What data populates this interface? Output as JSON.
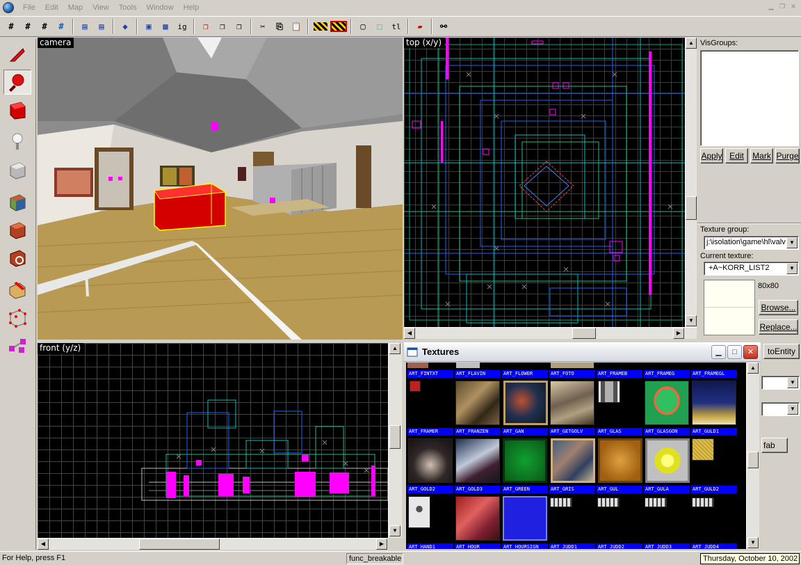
{
  "menu": {
    "items": [
      "File",
      "Edit",
      "Map",
      "View",
      "Tools",
      "Window",
      "Help"
    ]
  },
  "views": {
    "camera": "camera",
    "top": "top (x/y)",
    "front": "front (y/z)"
  },
  "right_panel": {
    "visgroups_label": "VisGroups:",
    "apply": "Apply",
    "edit": "Edit",
    "mark": "Mark",
    "purge": "Purge",
    "texture_group_label": "Texture group:",
    "texture_group_value": "j:\\isolation\\game\\hl\\valv",
    "current_texture_label": "Current texture:",
    "current_texture_value": "+A~KORR_LIST2",
    "texture_size": "80x80",
    "browse": "Browse...",
    "replace": "Replace...",
    "to_entity": "toEntity",
    "prefab_fragment": "fab"
  },
  "textures_window": {
    "title": "Textures",
    "rows": [
      [
        "ART_FINTXT",
        "ART_FLAVIN",
        "ART_FLOWER",
        "ART_FOTO",
        "ART_FRAMEB",
        "ART_FRAMEG",
        "ART_FRAMEGL"
      ],
      [
        "ART_FRAMER",
        "ART_FRANZEN",
        "ART_GAN",
        "ART_GETGOLV",
        "ART_GLAS",
        "ART_GLASGON",
        "ART_GULD1"
      ],
      [
        "ART_GOLD2",
        "ART_GOLD3",
        "ART_GREEN",
        "ART_GRIS",
        "ART_GUL",
        "ART_GULA",
        "ART_GULD2"
      ],
      [
        "ART_HAND1",
        "ART_HOUR",
        "ART_HOURSIGN",
        "ART_JUDD1",
        "ART_JUDD2",
        "ART_JUDD3",
        "ART_JUDD4"
      ]
    ]
  },
  "status": {
    "help": "For Help, press F1",
    "selection": "func_breakable",
    "date": "Thursday, October 10, 2002"
  },
  "colors": {
    "selected_brush": "#d40000",
    "entity_magenta": "#ff00ff",
    "texture_label_bg": "#0000ff",
    "grid_line": "#3d3d3d"
  }
}
